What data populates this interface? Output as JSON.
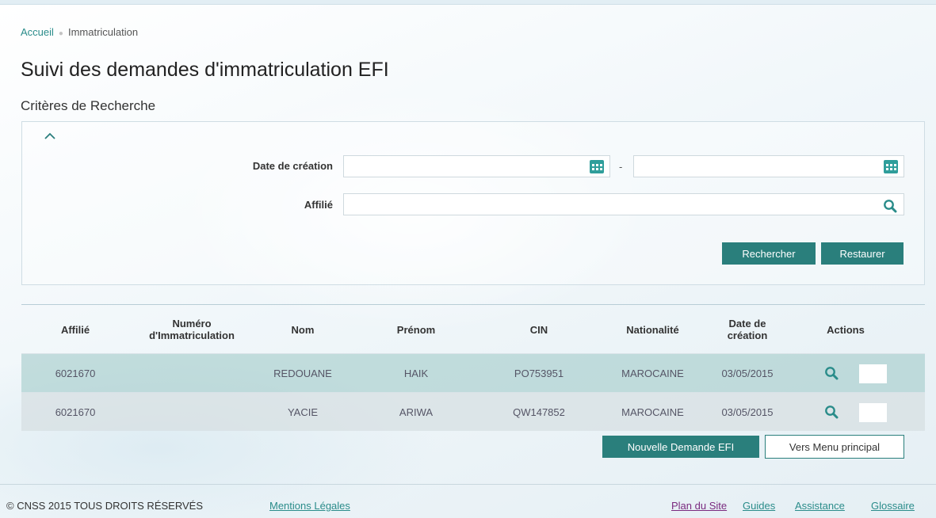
{
  "breadcrumb": {
    "home": "Accueil",
    "current": "Immatriculation"
  },
  "page_title": "Suivi des demandes d'immatriculation EFI",
  "criteria": {
    "title": "Critères de Recherche",
    "date_label": "Date de création",
    "date_from": "",
    "date_to": "",
    "date_separator": "-",
    "affilie_label": "Affilié",
    "affilie_value": "",
    "search_button": "Rechercher",
    "reset_button": "Restaurer"
  },
  "table": {
    "headers": [
      "Affilié",
      "Numéro d'Immatriculation",
      "Nom",
      "Prénom",
      "CIN",
      "Nationalité",
      "Date de création",
      "Actions"
    ],
    "rows": [
      [
        "6021670",
        "",
        "REDOUANE",
        "HAIK",
        "PO753951",
        "MAROCAINE",
        "03/05/2015"
      ],
      [
        "6021670",
        "",
        "YACIE",
        "ARIWA",
        "QW147852",
        "MAROCAINE",
        "03/05/2015"
      ]
    ]
  },
  "actions": {
    "new_request": "Nouvelle Demande EFI",
    "main_menu": "Vers Menu principal"
  },
  "footer": {
    "copyright": "© CNSS 2015 TOUS DROITS RÉSERVÉS",
    "legal": "Mentions Légales",
    "sitemap": "Plan du Site",
    "guides": "Guides",
    "assistance": "Assistance",
    "glossary": "Glossaire"
  },
  "colors": {
    "accent": "#2a7f7c",
    "link": "#2a8c8a",
    "visited_link": "#7a2a7f",
    "selected_row": "#9ac6c4",
    "alt_row": "#d6dee1"
  },
  "icons": {
    "calendar": "calendar-icon",
    "search": "search-icon",
    "collapse": "chevron-up-icon"
  }
}
